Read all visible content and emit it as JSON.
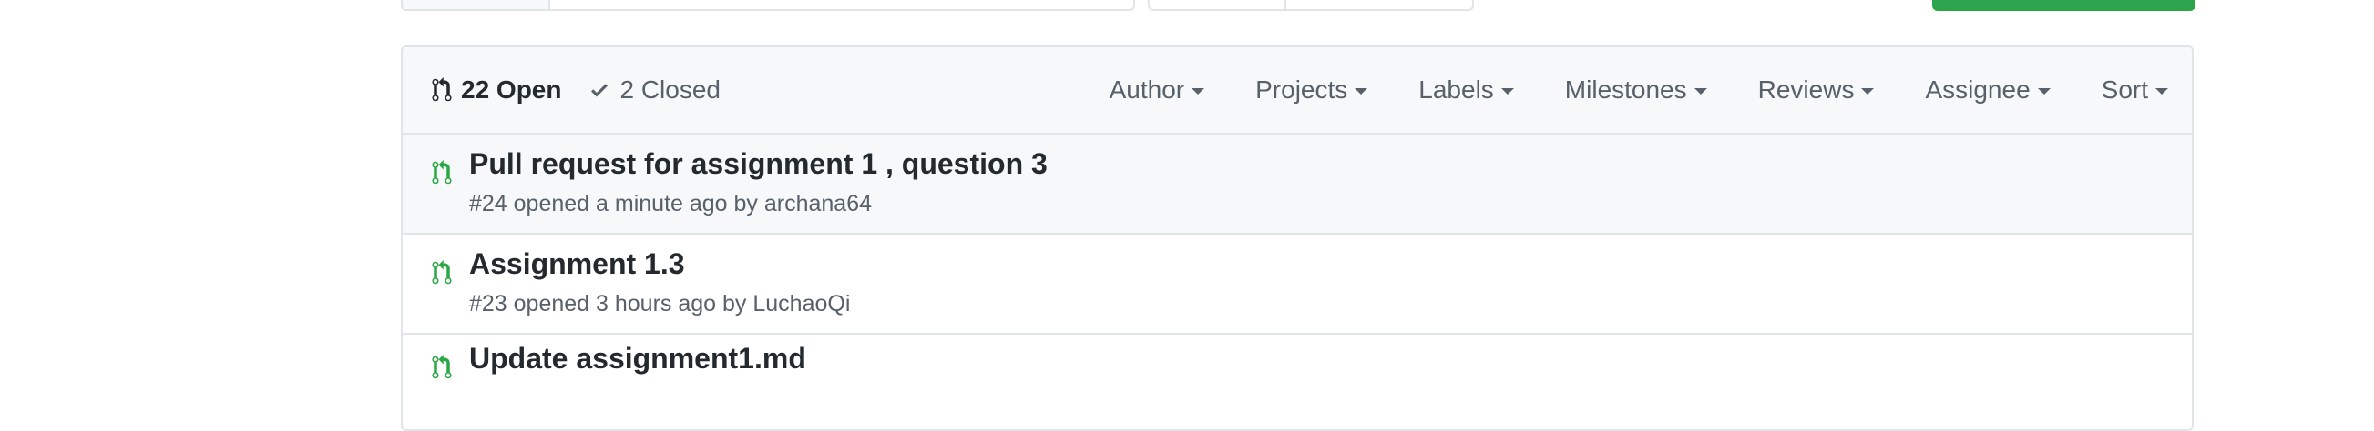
{
  "colors": {
    "open_icon": "#28a745",
    "text_primary": "#24292e",
    "text_muted": "#586069",
    "border": "#e1e4e8",
    "header_bg": "#f6f8fa",
    "new_button": "#2ea44f"
  },
  "states": {
    "open_label": "22 Open",
    "closed_label": "2 Closed",
    "open_icon": "git-pull-request-icon",
    "closed_icon": "check-icon"
  },
  "filters": [
    {
      "label": "Author"
    },
    {
      "label": "Projects"
    },
    {
      "label": "Labels"
    },
    {
      "label": "Milestones"
    },
    {
      "label": "Reviews"
    },
    {
      "label": "Assignee"
    },
    {
      "label": "Sort"
    }
  ],
  "pull_requests": [
    {
      "title": "Pull request for assignment 1 , question 3",
      "meta": "#24 opened a minute ago by archana64"
    },
    {
      "title": "Assignment 1.3",
      "meta": "#23 opened 3 hours ago by LuchaoQi"
    },
    {
      "title": "Update assignment1.md",
      "meta": ""
    }
  ]
}
